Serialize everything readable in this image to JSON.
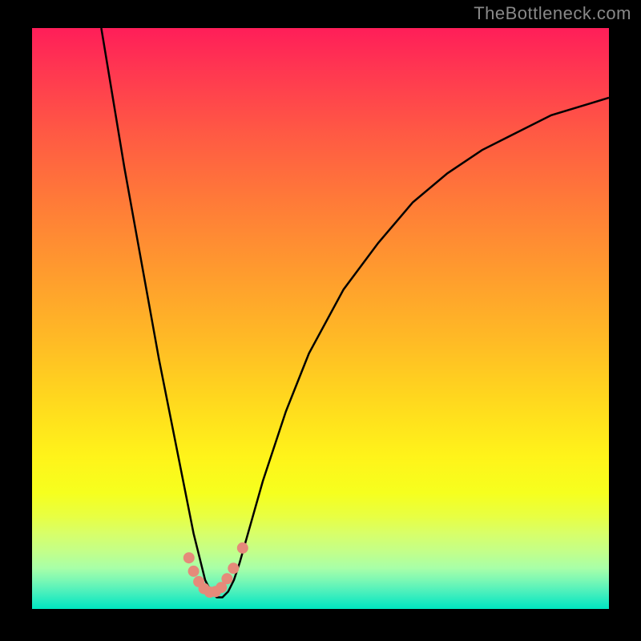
{
  "watermark": "TheBottleneck.com",
  "chart_data": {
    "type": "line",
    "title": "",
    "xlabel": "",
    "ylabel": "",
    "xlim": [
      0,
      100
    ],
    "ylim": [
      0,
      100
    ],
    "series": [
      {
        "name": "bottleneck-curve",
        "x": [
          12,
          14,
          16,
          18,
          20,
          22,
          24,
          26,
          27,
          28,
          29,
          30,
          31,
          32,
          33,
          34,
          35,
          36,
          38,
          40,
          44,
          48,
          54,
          60,
          66,
          72,
          78,
          84,
          90,
          100
        ],
        "values": [
          100,
          88,
          76,
          65,
          54,
          43,
          33,
          23,
          18,
          13,
          9,
          5,
          3,
          2,
          2,
          3,
          5,
          8,
          15,
          22,
          34,
          44,
          55,
          63,
          70,
          75,
          79,
          82,
          85,
          88
        ]
      }
    ],
    "markers": {
      "name": "highlight-points",
      "points": [
        {
          "x": 27.2,
          "y": 91.2
        },
        {
          "x": 28.0,
          "y": 93.5
        },
        {
          "x": 28.9,
          "y": 95.3
        },
        {
          "x": 29.8,
          "y": 96.5
        },
        {
          "x": 30.8,
          "y": 97.1
        },
        {
          "x": 31.8,
          "y": 97.0
        },
        {
          "x": 32.8,
          "y": 96.3
        },
        {
          "x": 33.8,
          "y": 94.8
        },
        {
          "x": 34.9,
          "y": 93.0
        },
        {
          "x": 36.5,
          "y": 89.5
        }
      ]
    },
    "background_gradient": {
      "direction": "vertical",
      "stops": [
        {
          "pos": 0,
          "color": "#ff1e59"
        },
        {
          "pos": 50,
          "color": "#ffbb25"
        },
        {
          "pos": 80,
          "color": "#f6ff1e"
        },
        {
          "pos": 95,
          "color": "#7cf8b4"
        },
        {
          "pos": 100,
          "color": "#00e6c0"
        }
      ]
    }
  }
}
